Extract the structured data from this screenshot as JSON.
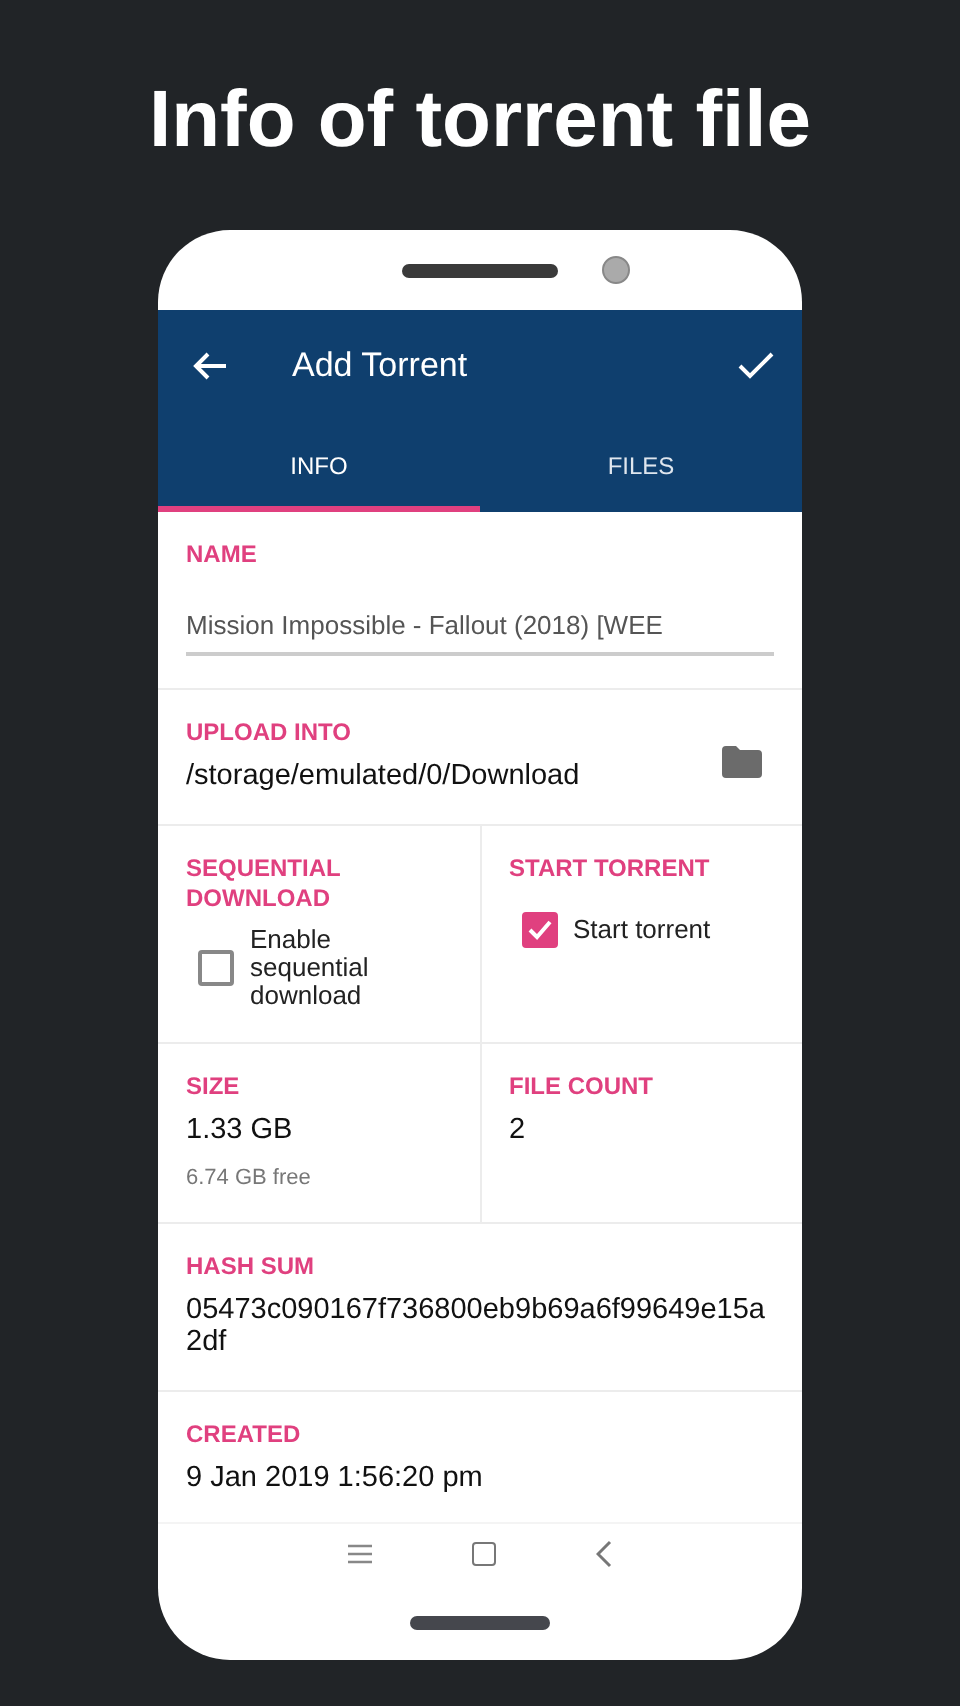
{
  "headline": "Info of torrent file",
  "app_bar": {
    "title": "Add Torrent"
  },
  "tabs": [
    {
      "label": "INFO",
      "selected": true
    },
    {
      "label": "FILES",
      "selected": false
    }
  ],
  "rows": [
    {
      "cells": [
        {
          "kind": "input",
          "label": "NAME",
          "value": "Mission Impossible - Fallout (2018) [WEE"
        }
      ]
    },
    {
      "cells": [
        {
          "kind": "path",
          "label": "UPLOAD INTO",
          "value": "/storage/emulated/0/Download"
        }
      ]
    },
    {
      "cells": [
        {
          "kind": "checkbox",
          "label": "SEQUENTIAL DOWNLOAD",
          "text": "Enable sequential download",
          "checked": false
        },
        {
          "kind": "checkbox",
          "label": "START TORRENT",
          "text": "Start torrent",
          "checked": true
        }
      ]
    },
    {
      "cells": [
        {
          "kind": "value",
          "label": "SIZE",
          "value": "1.33 GB",
          "note": "6.74 GB free"
        },
        {
          "kind": "value",
          "label": "FILE COUNT",
          "value": "2"
        }
      ]
    },
    {
      "cells": [
        {
          "kind": "value",
          "label": "HASH SUM",
          "value": "05473c090167f736800eb9b69a6f99649e15a2df"
        }
      ]
    },
    {
      "cells": [
        {
          "kind": "value",
          "label": "CREATED",
          "value": "9 Jan 2019 1:56:20 pm"
        }
      ]
    }
  ]
}
